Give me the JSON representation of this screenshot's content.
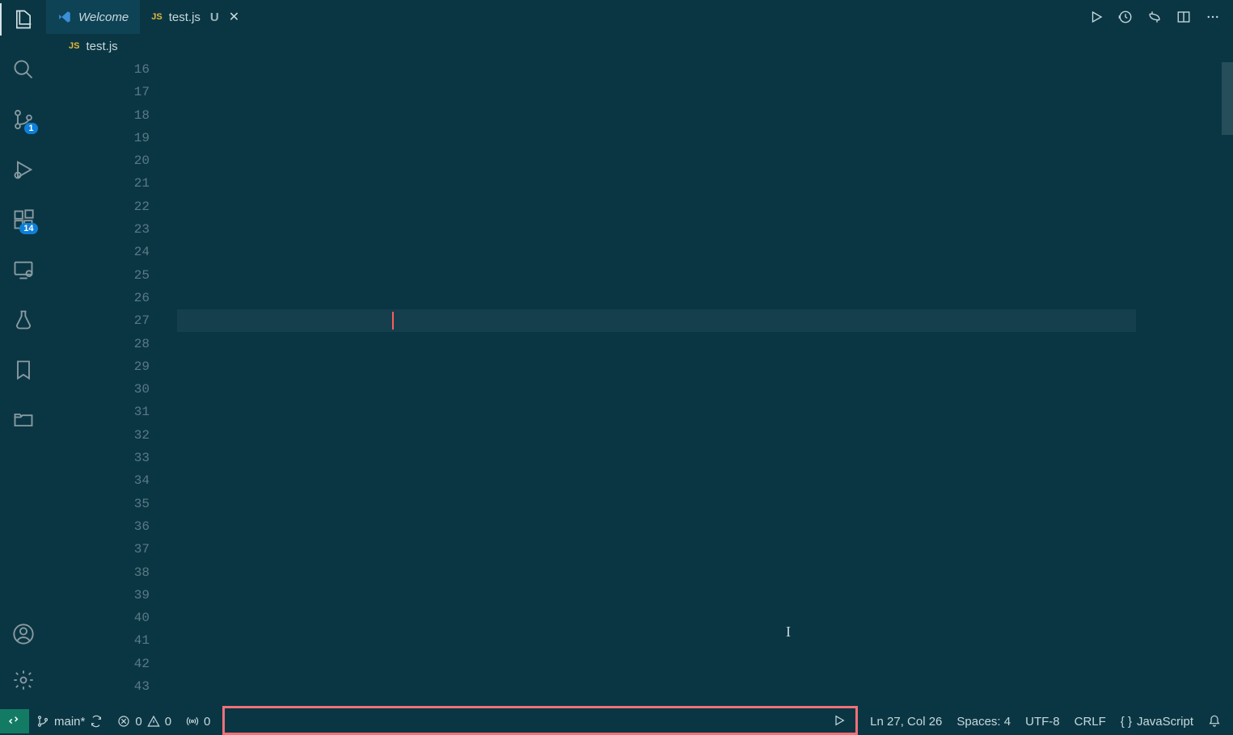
{
  "tabs": {
    "welcome": "Welcome",
    "file": "test.js",
    "modified": "U"
  },
  "breadcrumb": {
    "file": "test.js"
  },
  "editor": {
    "line_start": 16,
    "line_end": 43,
    "cursor_line": 27
  },
  "activity": {
    "scm_badge": "1",
    "ext_badge": "14"
  },
  "status": {
    "branch": "main*",
    "errors": "0",
    "warnings": "0",
    "ports": "0",
    "cursor": "Ln 27, Col 26",
    "spaces": "Spaces: 4",
    "encoding": "UTF-8",
    "eol": "CRLF",
    "lang": "JavaScript"
  }
}
